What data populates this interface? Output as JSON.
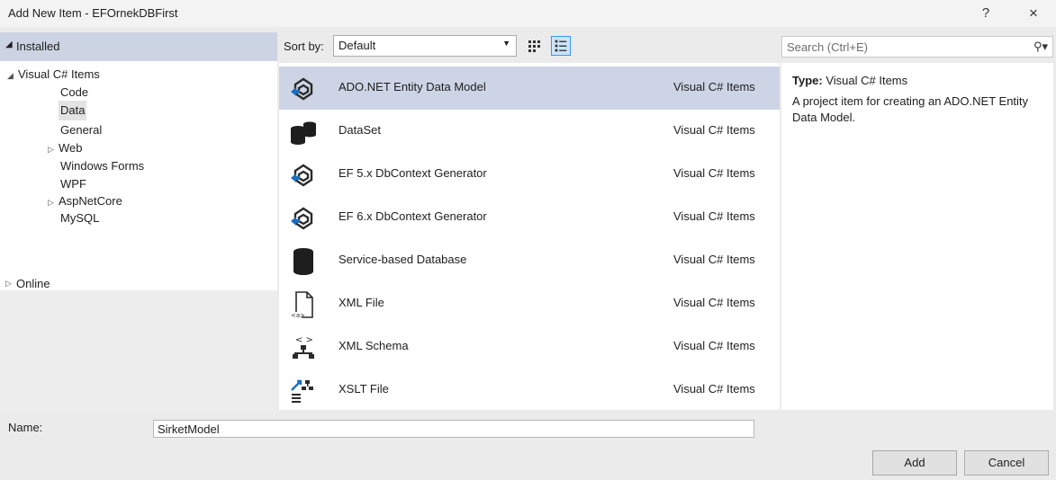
{
  "window": {
    "title": "Add New Item - EFOrnekDBFirst",
    "help_label": "?",
    "close_label": "×"
  },
  "tree": {
    "installed_label": "Installed",
    "items": [
      {
        "label": "Visual C# Items"
      },
      {
        "label": "Code"
      },
      {
        "label": "Data"
      },
      {
        "label": "General"
      },
      {
        "label": "Web"
      },
      {
        "label": "Windows Forms"
      },
      {
        "label": "WPF"
      },
      {
        "label": "AspNetCore"
      },
      {
        "label": "MySQL"
      }
    ],
    "online_label": "Online"
  },
  "toolbar": {
    "sort_by_label": "Sort by:",
    "sort_value": "Default"
  },
  "search": {
    "placeholder": "Search (Ctrl+E)"
  },
  "items": [
    {
      "name": "ADO.NET Entity Data Model",
      "category": "Visual C# Items",
      "icon": "entity-model-icon"
    },
    {
      "name": "DataSet",
      "category": "Visual C# Items",
      "icon": "dataset-icon"
    },
    {
      "name": "EF 5.x DbContext Generator",
      "category": "Visual C# Items",
      "icon": "ef5-generator-icon"
    },
    {
      "name": "EF 6.x DbContext Generator",
      "category": "Visual C# Items",
      "icon": "ef6-generator-icon"
    },
    {
      "name": "Service-based Database",
      "category": "Visual C# Items",
      "icon": "database-icon"
    },
    {
      "name": "XML File",
      "category": "Visual C# Items",
      "icon": "xml-file-icon"
    },
    {
      "name": "XML Schema",
      "category": "Visual C# Items",
      "icon": "xml-schema-icon"
    },
    {
      "name": "XSLT File",
      "category": "Visual C# Items",
      "icon": "xslt-file-icon"
    }
  ],
  "details": {
    "type_label": "Type:",
    "type_value": "Visual C# Items",
    "description": "A project item for creating an ADO.NET Entity Data Model."
  },
  "bottom": {
    "name_label": "Name:",
    "name_value": "SirketModel",
    "add_label": "Add",
    "cancel_label": "Cancel"
  },
  "colors": {
    "selected_row": "#cdd4e5",
    "header_band": "#ccd3e2",
    "dialog_bg": "#ebebeb"
  }
}
